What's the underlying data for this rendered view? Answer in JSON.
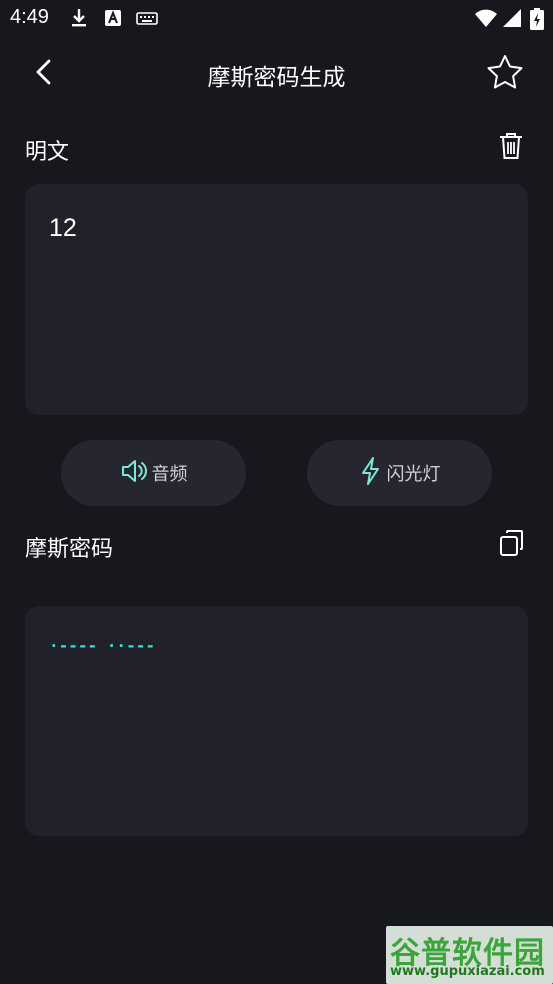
{
  "status_bar": {
    "time": "4:49",
    "icons": [
      "download-icon",
      "a-letter-icon",
      "keyboard-icon",
      "wifi-icon",
      "signal-icon",
      "battery-charging-icon"
    ]
  },
  "app_bar": {
    "title": "摩斯密码生成",
    "back_icon": "chevron-left-icon",
    "favorite_icon": "star-outline-icon"
  },
  "plaintext_section": {
    "label": "明文",
    "clear_icon": "trash-icon",
    "input_value": "12"
  },
  "actions": {
    "audio_label": "音频",
    "audio_icon": "speaker-icon",
    "flashlight_label": "闪光灯",
    "flashlight_icon": "lightning-icon"
  },
  "morse_section": {
    "label": "摩斯密码",
    "copy_icon": "copy-icon",
    "output_value": "·----  ··---"
  },
  "watermark": {
    "title": "谷普软件园",
    "url": "www.gupuxiazai.com"
  },
  "colors": {
    "background": "#17171e",
    "card": "#212129",
    "pill": "#262630",
    "accent": "#2de0e8",
    "icon_accent": "#7fe6d2"
  }
}
